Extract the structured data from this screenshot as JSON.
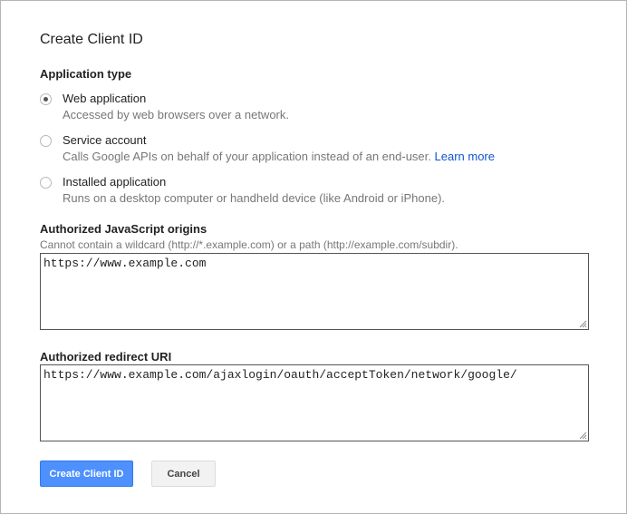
{
  "dialog": {
    "title": "Create Client ID"
  },
  "application_type": {
    "heading": "Application type",
    "options": [
      {
        "label": "Web application",
        "description": "Accessed by web browsers over a network.",
        "checked": true
      },
      {
        "label": "Service account",
        "description": "Calls Google APIs on behalf of your application instead of an end-user.",
        "link": "Learn more",
        "checked": false
      },
      {
        "label": "Installed application",
        "description": "Runs on a desktop computer or handheld device (like Android or iPhone).",
        "checked": false
      }
    ]
  },
  "js_origins": {
    "heading": "Authorized JavaScript origins",
    "hint": "Cannot contain a wildcard (http://*.example.com) or a path (http://example.com/subdir).",
    "value": "https://www.example.com"
  },
  "redirect_uri": {
    "heading": "Authorized redirect URI",
    "value": "https://www.example.com/ajaxlogin/oauth/acceptToken/network/google/"
  },
  "buttons": {
    "create_label": "Create Client ID",
    "cancel_label": "Cancel"
  },
  "colors": {
    "primary_button": "#4d90fe",
    "link": "#1155cc",
    "description_text": "#777777"
  }
}
